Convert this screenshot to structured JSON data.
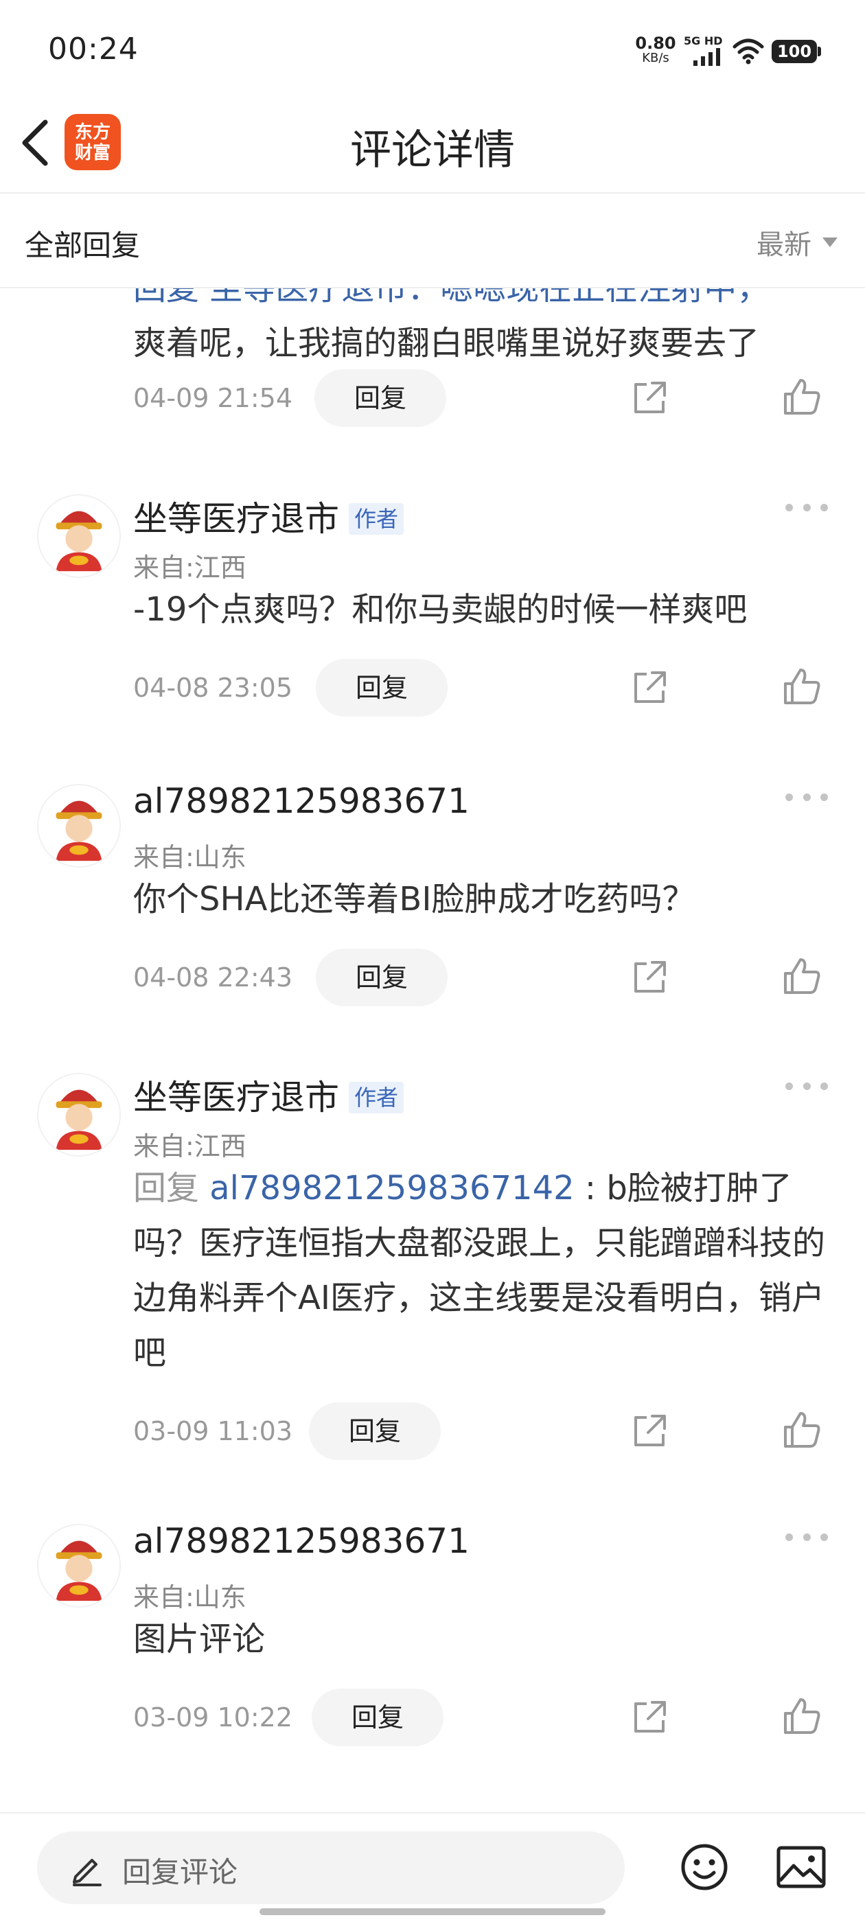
{
  "status_bar": {
    "time": "00:24",
    "net_speed_value": "0.80",
    "net_speed_unit": "KB/s",
    "signal_label": "5G HD",
    "battery": "100"
  },
  "header": {
    "logo_line1": "东方",
    "logo_line2": "财富",
    "title": "评论详情"
  },
  "filter": {
    "title": "全部回复",
    "sort_label": "最新"
  },
  "comments": [
    {
      "partial": true,
      "content_line1": "回复 坐等医疗退市：嗯嗯现在正在注射中，",
      "content_line2": "爽着呢，让我搞的翻白眼嘴里说好爽要去了",
      "time": "04-09 21:54",
      "reply_label": "回复"
    },
    {
      "username": "坐等医疗退市",
      "author_tag": "作者",
      "location": "来自:江西",
      "content": "-19个点爽吗？和你马卖龈的时候一样爽吧",
      "time": "04-08 23:05",
      "reply_label": "回复"
    },
    {
      "username": "al78982125983671",
      "location": "来自:山东",
      "content": "你个SHA比还等着BI脸肿成才吃药吗？",
      "time": "04-08 22:43",
      "reply_label": "回复"
    },
    {
      "username": "坐等医疗退市",
      "author_tag": "作者",
      "location": "来自:江西",
      "reply_prefix": "回复 ",
      "mention": "al7898212598367142",
      "reply_colon": " : ",
      "content": "b脸被打肿了吗？医疗连恒指大盘都没跟上，只能蹭蹭科技的边角料弄个AI医疗，这主线要是没看明白，销户吧",
      "time": "03-09 11:03",
      "reply_label": "回复"
    },
    {
      "username": "al78982125983671",
      "location": "来自:山东",
      "content": "图片评论",
      "time": "03-09 10:22",
      "reply_label": "回复"
    }
  ],
  "bottom_bar": {
    "reply_placeholder": "回复评论"
  },
  "colors": {
    "brand": "#f0531f",
    "mention": "#3a64a8",
    "author_tag_bg": "#eaf1fb"
  },
  "icons": [
    "back-arrow-icon",
    "more-icon",
    "share-icon",
    "like-icon",
    "pencil-icon",
    "emoji-icon",
    "image-icon",
    "wifi-icon",
    "signal-icon"
  ]
}
